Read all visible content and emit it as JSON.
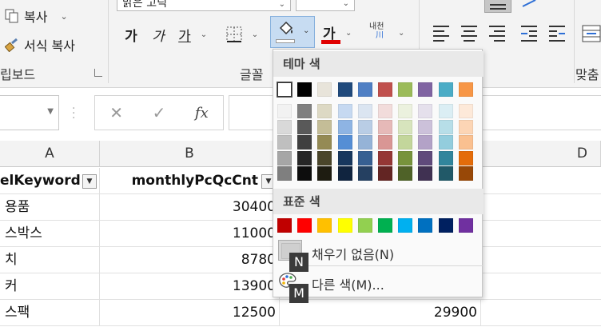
{
  "ribbon": {
    "clipboard": {
      "copy_label": "복사",
      "format_painter_label": "서식 복사",
      "group_label": "립보드"
    },
    "font": {
      "font_name": "맑은 고딕",
      "bold": "가",
      "italic": "가",
      "underline": "가",
      "font_color_glyph": "가",
      "group_label": "글꼴",
      "font_color_hex": "#e00000"
    },
    "alignment": {
      "wrap_label_top": "내천",
      "wrap_label_bottom": "川",
      "group_label": "맞춤"
    }
  },
  "formula_bar": {
    "cancel": "✕",
    "enter": "✓",
    "fx": "fx"
  },
  "sheet": {
    "columns": [
      "A",
      "B",
      "D"
    ],
    "header_row": {
      "a": "elKeyword",
      "b": "monthlyPcQcCnt"
    },
    "rows": [
      {
        "a": "용품",
        "b": "30400",
        "d": ""
      },
      {
        "a": "스박스",
        "b": "11000",
        "d": ""
      },
      {
        "a": "치",
        "b": "8780",
        "d": ""
      },
      {
        "a": "커",
        "b": "13900",
        "d": ""
      },
      {
        "a": "스팩",
        "b": "12500",
        "d": "29900"
      }
    ]
  },
  "fill_menu": {
    "theme_title": "테마 색",
    "standard_title": "표준 색",
    "no_fill": "채우기 없음(N)",
    "more_colors": "다른 색(M)...",
    "keytip_n": "N",
    "keytip_m": "M",
    "theme_colors": [
      "#ffffff",
      "#000000",
      "#e7e6e6",
      "#44546a",
      "#4472c4",
      "#ed7d31",
      "#a5a5a5",
      "#ffc000",
      "#5b9bd5",
      "#70ad47"
    ],
    "theme_row_colors": [
      "#ffffff",
      "#000000",
      "#e8e4da",
      "#204a7c",
      "#4f7fc4",
      "#c0504d",
      "#9bbb59",
      "#8064a2",
      "#4bacc6",
      "#f79646"
    ],
    "shades": [
      [
        "#f2f2f2",
        "#7f7f7f",
        "#ddd9c4",
        "#c6d9f1",
        "#dbe5f1",
        "#f2dcdb",
        "#ebf1de",
        "#e5e0ec",
        "#dbeef4",
        "#fde9d9"
      ],
      [
        "#d9d9d9",
        "#595959",
        "#c4bd97",
        "#8eb4e3",
        "#b9cde5",
        "#e6b9b8",
        "#d7e4bd",
        "#ccc1da",
        "#b7dee8",
        "#fcd5b5"
      ],
      [
        "#bfbfbf",
        "#3f3f3f",
        "#948a54",
        "#558ed5",
        "#95b3d7",
        "#d99694",
        "#c3d69b",
        "#b3a2c7",
        "#93cddd",
        "#fac090"
      ],
      [
        "#a6a6a6",
        "#262626",
        "#4a452a",
        "#17375e",
        "#376092",
        "#953735",
        "#77933c",
        "#604a7b",
        "#31859c",
        "#e46c0a"
      ],
      [
        "#7f7f7f",
        "#0d0d0d",
        "#1e1c11",
        "#10243f",
        "#254061",
        "#632523",
        "#4f6228",
        "#403152",
        "#215968",
        "#984807"
      ]
    ],
    "standard_colors": [
      "#c00000",
      "#ff0000",
      "#ffc000",
      "#ffff00",
      "#92d050",
      "#00b050",
      "#00b0f0",
      "#0070c0",
      "#002060",
      "#7030a0"
    ]
  }
}
